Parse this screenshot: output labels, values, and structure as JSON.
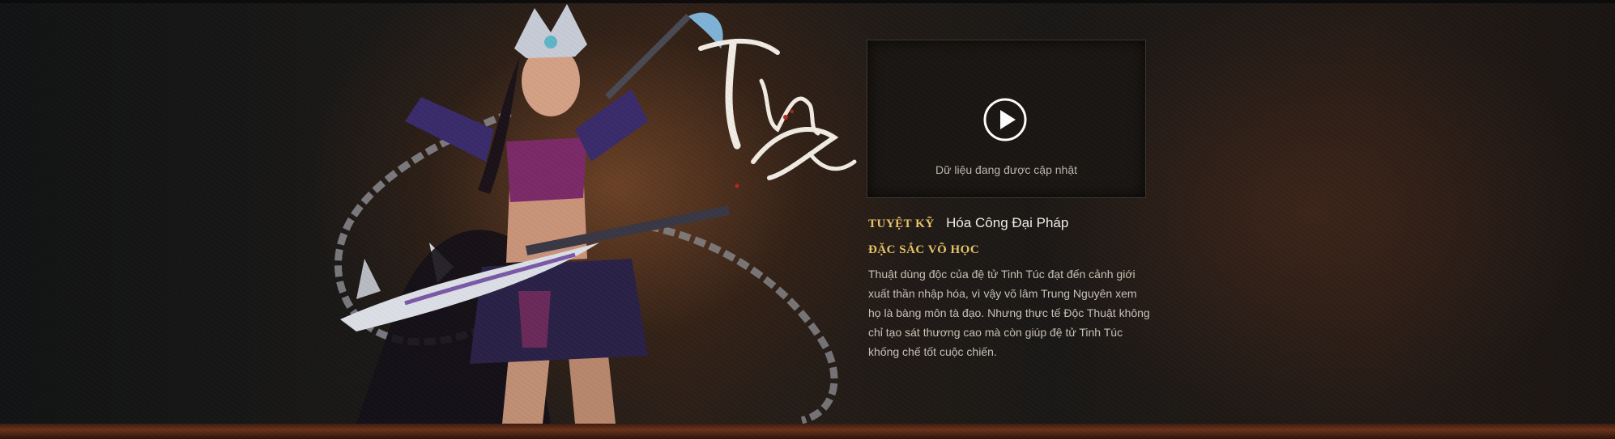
{
  "video": {
    "caption": "Dữ liệu đang được cập nhật",
    "play_icon": "play-icon"
  },
  "skill": {
    "label": "TUYỆT KỸ",
    "name": "Hóa Công Đại Pháp"
  },
  "feature": {
    "title": "ĐẶC SẮC VÕ HỌC",
    "description": "Thuật dùng độc của đệ tử Tinh Túc đạt đến cảnh giới xuất thần nhập hóa, vì vậy võ lâm Trung Nguyên xem họ  là bàng môn tà đạo. Nhưng thực tế Độc Thuật không chỉ tạo sát thương cao mà còn giúp đệ tử Tinh Túc khống chế tốt cuộc chiến."
  },
  "colors": {
    "accent_gold": "#e9c46a",
    "body_text": "#c9c2b7",
    "video_bg": "#1a1613"
  }
}
